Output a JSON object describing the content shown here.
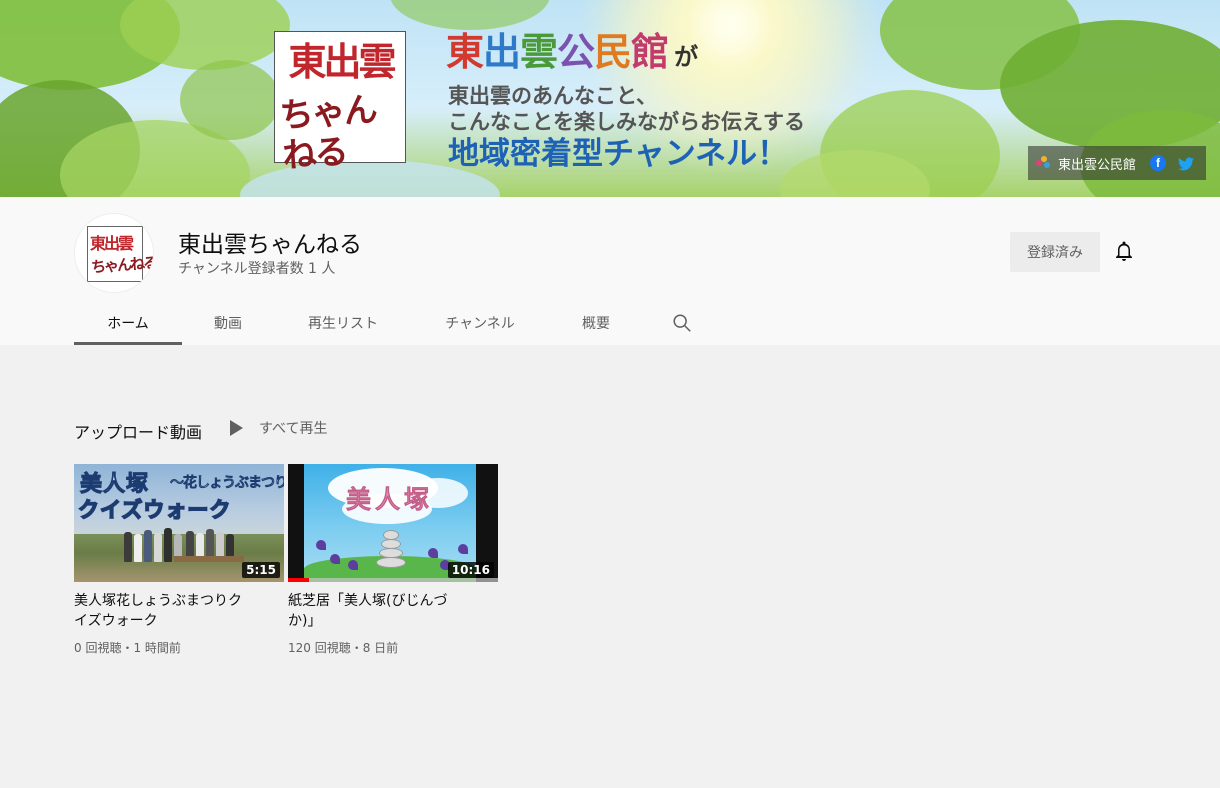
{
  "banner": {
    "logo_line1": "東出雲",
    "logo_line2": "ちゃんねる",
    "title_chars": [
      "東",
      "出",
      "雲",
      "公",
      "民",
      "館"
    ],
    "title_suffix": "が",
    "line1": "東出雲のあんなこと、",
    "line2": "こんなことを楽しみながらお伝えする",
    "tagline": "地域密着型チャンネル！",
    "social_link_label": "東出雲公民館",
    "facebook_glyph": "f"
  },
  "channel": {
    "avatar_line1": "東出雲",
    "avatar_line2": "ちゃんねる",
    "name": "東出雲ちゃんねる",
    "subscribers": "チャンネル登録者数 1 人",
    "subscribe_button": "登録済み"
  },
  "tabs": [
    "ホーム",
    "動画",
    "再生リスト",
    "チャンネル",
    "概要"
  ],
  "active_tab": 0,
  "shelf": {
    "title": "アップロード動画",
    "play_all": "すべて再生"
  },
  "videos": [
    {
      "title": "美人塚花しょうぶまつりクイズウォーク",
      "meta": "0 回視聴・1 時間前",
      "duration": "5:15",
      "thumb_text1": "美人塚",
      "thumb_text2": "～花しょうぶまつり",
      "thumb_text3": "クイズウォーク",
      "watched_fraction": 0
    },
    {
      "title": "紙芝居「美人塚(びじんづか)」",
      "meta": "120 回視聴・8 日前",
      "duration": "10:16",
      "thumb_text1": "美人塚",
      "watched_fraction": 0.1
    }
  ],
  "colors": {
    "accent_red": "#ff0000",
    "logo_red": "#c0262c",
    "tagline_blue": "#1e62b6",
    "page_bg": "#f1f1f1",
    "header_bg": "#f9f9f9"
  },
  "icons": [
    "bell-icon",
    "search-icon",
    "play-icon",
    "facebook-icon",
    "twitter-icon",
    "link-icon"
  ]
}
